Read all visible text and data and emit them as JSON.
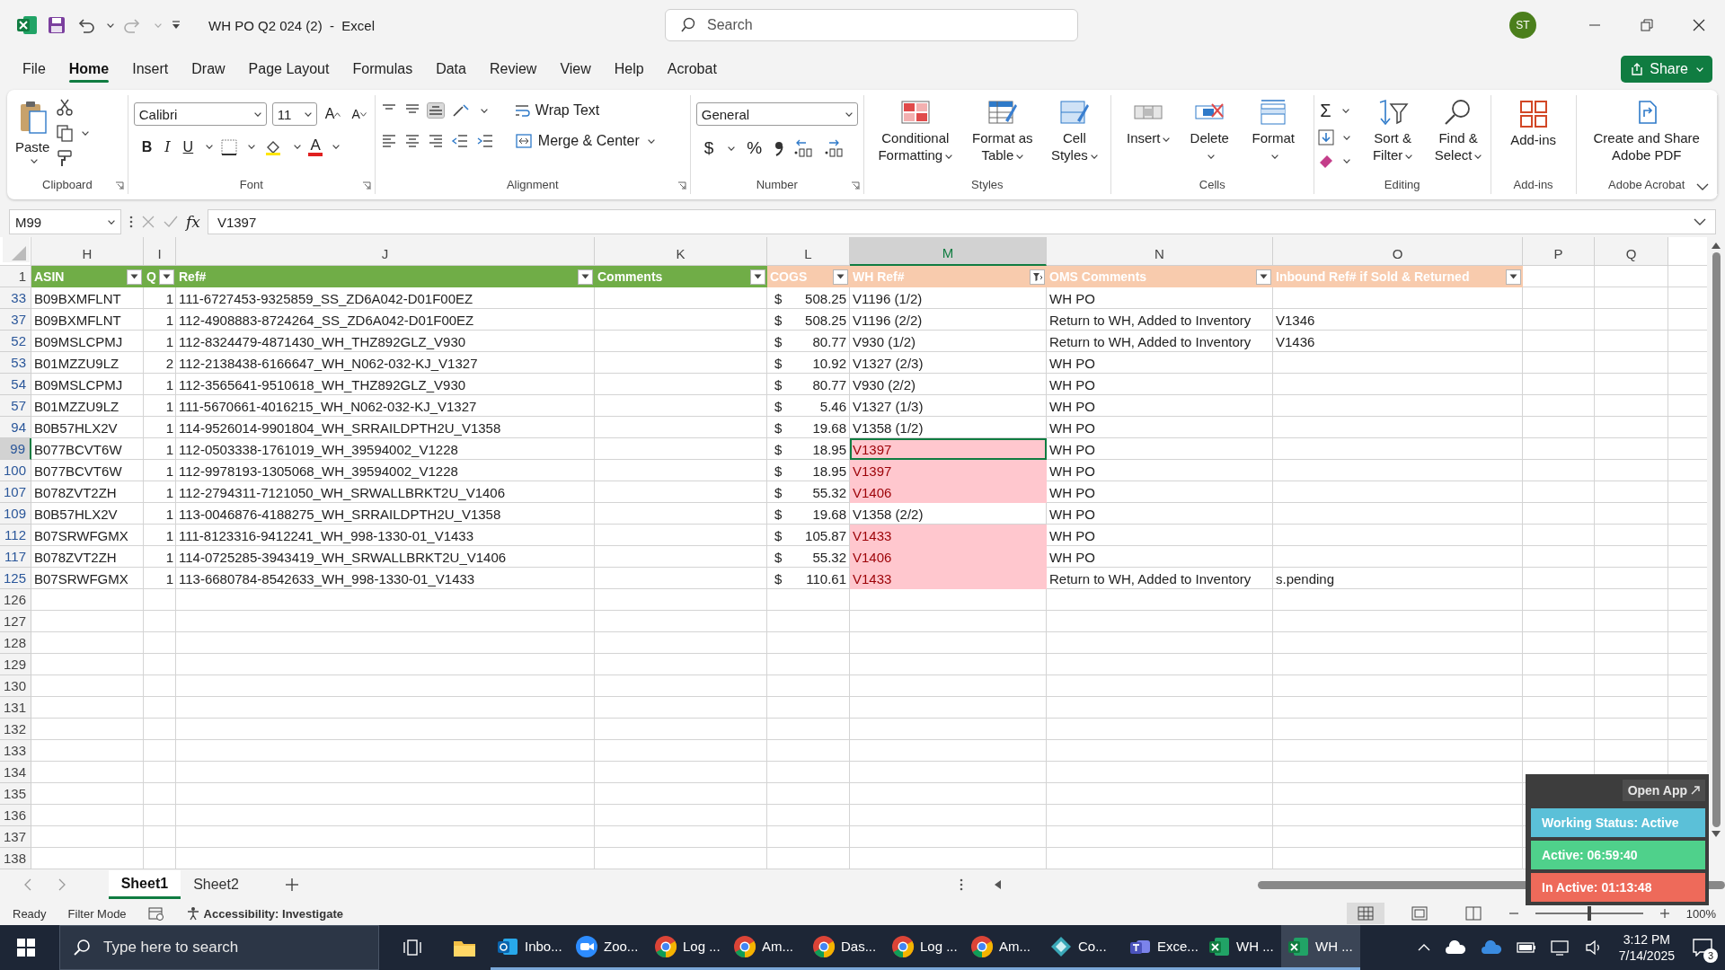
{
  "title_bar": {
    "window_title": "WH PO Q2 024 (2)  -  Excel",
    "search_placeholder": "Search",
    "avatar": "ST"
  },
  "menu_tabs": [
    {
      "label": "File",
      "selected": false
    },
    {
      "label": "Home",
      "selected": true
    },
    {
      "label": "Insert",
      "selected": false
    },
    {
      "label": "Draw",
      "selected": false
    },
    {
      "label": "Page Layout",
      "selected": false
    },
    {
      "label": "Formulas",
      "selected": false
    },
    {
      "label": "Data",
      "selected": false
    },
    {
      "label": "Review",
      "selected": false
    },
    {
      "label": "View",
      "selected": false
    },
    {
      "label": "Help",
      "selected": false
    },
    {
      "label": "Acrobat",
      "selected": false
    }
  ],
  "share_button": "Share",
  "ribbon": [
    {
      "kind": "clipboard",
      "label": "Clipboard",
      "paste": "Paste"
    },
    {
      "kind": "font",
      "label": "Font",
      "font_family": "Calibri",
      "font_size": "11",
      "grow_font": "A",
      "shrink_font": "A",
      "bold": "B",
      "italic": "I",
      "underline": "U",
      "font_color": "A"
    },
    {
      "kind": "alignment",
      "label": "Alignment",
      "wrap_text": "Wrap Text",
      "merge": "Merge & Center"
    },
    {
      "kind": "number",
      "label": "Number",
      "format": "General",
      "currency": "$",
      "percent": "%"
    },
    {
      "kind": "large",
      "label": "Styles",
      "buttons": [
        {
          "kind": "conditional",
          "label": "Conditional Formatting",
          "dropdown": true
        },
        {
          "kind": "table",
          "label": "Format as Table",
          "dropdown": true
        },
        {
          "kind": "cellstyles",
          "label": "Cell Styles",
          "dropdown": true
        }
      ]
    },
    {
      "kind": "large",
      "label": "Cells",
      "buttons": [
        {
          "kind": "insert",
          "label": "Insert",
          "dropdown": true
        },
        {
          "kind": "delete",
          "label": "Delete",
          "dropdown": true
        },
        {
          "kind": "format",
          "label": "Format",
          "dropdown": true
        }
      ]
    },
    {
      "kind": "editing",
      "label": "Editing",
      "autosum": "Σ",
      "buttons": [
        {
          "kind": "sort",
          "label": "Sort & Filter",
          "dropdown": true
        },
        {
          "kind": "find",
          "label": "Find & Select",
          "dropdown": true
        }
      ]
    },
    {
      "kind": "large",
      "label": "Add-ins",
      "buttons": [
        {
          "kind": "addins",
          "label": "Add-ins",
          "dropdown": false
        }
      ]
    },
    {
      "kind": "large",
      "label": "Adobe Acrobat",
      "buttons": [
        {
          "kind": "pdf",
          "label": "Create and Share Adobe PDF",
          "dropdown": false
        }
      ]
    }
  ],
  "formula_bar": {
    "name_box": "M99",
    "function_button": "fx",
    "formula": "V1397"
  },
  "sheet": {
    "columns": [
      {
        "letter": "H",
        "selected": false
      },
      {
        "letter": "I",
        "selected": false
      },
      {
        "letter": "J",
        "selected": false
      },
      {
        "letter": "K",
        "selected": false
      },
      {
        "letter": "L",
        "selected": false
      },
      {
        "letter": "M",
        "selected": true
      },
      {
        "letter": "N",
        "selected": false
      },
      {
        "letter": "O",
        "selected": false
      },
      {
        "letter": "P",
        "selected": false
      },
      {
        "letter": "Q",
        "selected": false
      }
    ],
    "header_row_number": "1",
    "headers": [
      {
        "label": "ASIN",
        "color": "#70ad47",
        "filter_applied": false
      },
      {
        "label": "Q",
        "color": "#70ad47",
        "filter_applied": false
      },
      {
        "label": "Ref#",
        "color": "#70ad47",
        "filter_applied": false
      },
      {
        "label": "Comments",
        "color": "#70ad47",
        "filter_applied": false
      },
      {
        "label": "COGS",
        "color": "#f8cbad",
        "filter_applied": false
      },
      {
        "label": "WH Ref#",
        "color": "#f8cbad",
        "filter_applied": true
      },
      {
        "label": "OMS Comments",
        "color": "#f8cbad",
        "filter_applied": false
      },
      {
        "label": "Inbound Ref# if Sold & Returned",
        "color": "#f8cbad",
        "filter_applied": false
      }
    ],
    "rows": [
      {
        "number": "33",
        "selected": false,
        "asin": "B09BXMFLNT",
        "qty": "1",
        "ref": "111-6727453-9325859_SS_ZD6A042-D01F00EZ",
        "currency": "$",
        "cogs": "508.25",
        "wh_ref": "V1196  (1/2)",
        "wh_ref_flagged": false,
        "oms_comments": "WH PO"
      },
      {
        "number": "37",
        "selected": false,
        "asin": "B09BXMFLNT",
        "qty": "1",
        "ref": "112-4908883-8724264_SS_ZD6A042-D01F00EZ",
        "currency": "$",
        "cogs": "508.25",
        "wh_ref": "V1196 (2/2)",
        "wh_ref_flagged": false,
        "oms_comments": "Return to WH, Added to Inventory",
        "inbound_ref": "V1346"
      },
      {
        "number": "52",
        "selected": false,
        "asin": "B09MSLCPMJ",
        "qty": "1",
        "ref": "112-8324479-4871430_WH_THZ892GLZ_V930",
        "currency": "$",
        "cogs": "80.77",
        "wh_ref": "V930 (1/2)",
        "wh_ref_flagged": false,
        "oms_comments": "Return to WH, Added to Inventory",
        "inbound_ref": "V1436"
      },
      {
        "number": "53",
        "selected": false,
        "asin": "B01MZZU9LZ",
        "qty": "2",
        "ref": "112-2138438-6166647_WH_N062-032-KJ_V1327",
        "currency": "$",
        "cogs": "10.92",
        "wh_ref": "V1327 (2/3)",
        "wh_ref_flagged": false,
        "oms_comments": "WH PO"
      },
      {
        "number": "54",
        "selected": false,
        "asin": "B09MSLCPMJ",
        "qty": "1",
        "ref": "112-3565641-9510618_WH_THZ892GLZ_V930",
        "currency": "$",
        "cogs": "80.77",
        "wh_ref": "V930 (2/2)",
        "wh_ref_flagged": false,
        "oms_comments": "WH PO"
      },
      {
        "number": "57",
        "selected": false,
        "asin": "B01MZZU9LZ",
        "qty": "1",
        "ref": "111-5670661-4016215_WH_N062-032-KJ_V1327",
        "currency": "$",
        "cogs": "5.46",
        "wh_ref": "V1327 (1/3)",
        "wh_ref_flagged": false,
        "oms_comments": "WH PO"
      },
      {
        "number": "94",
        "selected": false,
        "asin": "B0B57HLX2V",
        "qty": "1",
        "ref": "114-9526014-9901804_WH_SRRAILDPTH2U_V1358",
        "currency": "$",
        "cogs": "19.68",
        "wh_ref": "V1358 (1/2)",
        "wh_ref_flagged": false,
        "oms_comments": "WH PO"
      },
      {
        "number": "99",
        "selected": true,
        "asin": "B077BCVT6W",
        "qty": "1",
        "ref": "112-0503338-1761019_WH_39594002_V1228",
        "currency": "$",
        "cogs": "18.95",
        "wh_ref": "V1397",
        "wh_ref_flagged": true,
        "oms_comments": "WH PO"
      },
      {
        "number": "100",
        "selected": false,
        "asin": "B077BCVT6W",
        "qty": "1",
        "ref": "112-9978193-1305068_WH_39594002_V1228",
        "currency": "$",
        "cogs": "18.95",
        "wh_ref": "V1397",
        "wh_ref_flagged": true,
        "oms_comments": "WH PO"
      },
      {
        "number": "107",
        "selected": false,
        "asin": "B078ZVT2ZH",
        "qty": "1",
        "ref": "112-2794311-7121050_WH_SRWALLBRKT2U_V1406",
        "currency": "$",
        "cogs": "55.32",
        "wh_ref": "V1406",
        "wh_ref_flagged": true,
        "oms_comments": "WH PO"
      },
      {
        "number": "109",
        "selected": false,
        "asin": "B0B57HLX2V",
        "qty": "1",
        "ref": "113-0046876-4188275_WH_SRRAILDPTH2U_V1358",
        "currency": "$",
        "cogs": "19.68",
        "wh_ref": "V1358 (2/2)",
        "wh_ref_flagged": false,
        "oms_comments": "WH PO"
      },
      {
        "number": "112",
        "selected": false,
        "asin": "B07SRWFGMX",
        "qty": "1",
        "ref": "111-8123316-9412241_WH_998-1330-01_V1433",
        "currency": "$",
        "cogs": "105.87",
        "wh_ref": "V1433",
        "wh_ref_flagged": true,
        "oms_comments": "WH PO"
      },
      {
        "number": "117",
        "selected": false,
        "asin": "B078ZVT2ZH",
        "qty": "1",
        "ref": "114-0725285-3943419_WH_SRWALLBRKT2U_V1406",
        "currency": "$",
        "cogs": "55.32",
        "wh_ref": "V1406",
        "wh_ref_flagged": true,
        "oms_comments": "WH PO"
      },
      {
        "number": "125",
        "selected": false,
        "asin": "B07SRWFGMX",
        "qty": "1",
        "ref": "113-6680784-8542633_WH_998-1330-01_V1433",
        "currency": "$",
        "cogs": "110.61",
        "wh_ref": "V1433",
        "wh_ref_flagged": true,
        "oms_comments": "Return to WH, Added to Inventory",
        "inbound_ref": "s.pending"
      }
    ],
    "empty_rows": [
      "126",
      "127",
      "128",
      "129",
      "130",
      "131",
      "132",
      "133",
      "134",
      "135",
      "136",
      "137",
      "138"
    ]
  },
  "sheet_tabs": [
    {
      "label": "Sheet1",
      "selected": true
    },
    {
      "label": "Sheet2",
      "selected": false
    }
  ],
  "status_bar": {
    "mode": "Ready",
    "filter_mode": "Filter Mode",
    "accessibility": "Accessibility: Investigate",
    "zoom_slider": {
      "level": 0.5
    },
    "zoom": "100%"
  },
  "tracker_widget": {
    "open_app": "Open App",
    "statuses": [
      {
        "label": "Working Status: Active",
        "color": "#5bc0d8"
      },
      {
        "label": "Active: 06:59:40",
        "color": "#4fd18b"
      },
      {
        "label": "In Active: 01:13:48",
        "color": "#ee6a5a"
      }
    ]
  },
  "taskbar": {
    "search_placeholder": "Type here to search",
    "apps": [
      {
        "kind": "outlook",
        "label": "Inbo...",
        "selected": false
      },
      {
        "kind": "zoom",
        "label": "Zoo...",
        "selected": false
      },
      {
        "kind": "chrome",
        "label": "Log ...",
        "selected": false
      },
      {
        "kind": "chrome",
        "label": "Am...",
        "selected": false
      },
      {
        "kind": "chrome",
        "label": "Das...",
        "selected": false
      },
      {
        "kind": "chrome",
        "label": "Log ...",
        "selected": false
      },
      {
        "kind": "chrome",
        "label": "Am...",
        "selected": false
      },
      {
        "kind": "diamond",
        "label": "Co...",
        "selected": false
      },
      {
        "kind": "teams",
        "label": "Exce...",
        "selected": false
      },
      {
        "kind": "excel",
        "label": "WH ...",
        "selected": false
      },
      {
        "kind": "excel",
        "label": "WH ...",
        "selected": true
      }
    ],
    "time": "3:12 PM",
    "date": "7/14/2025",
    "notifications": "3"
  }
}
